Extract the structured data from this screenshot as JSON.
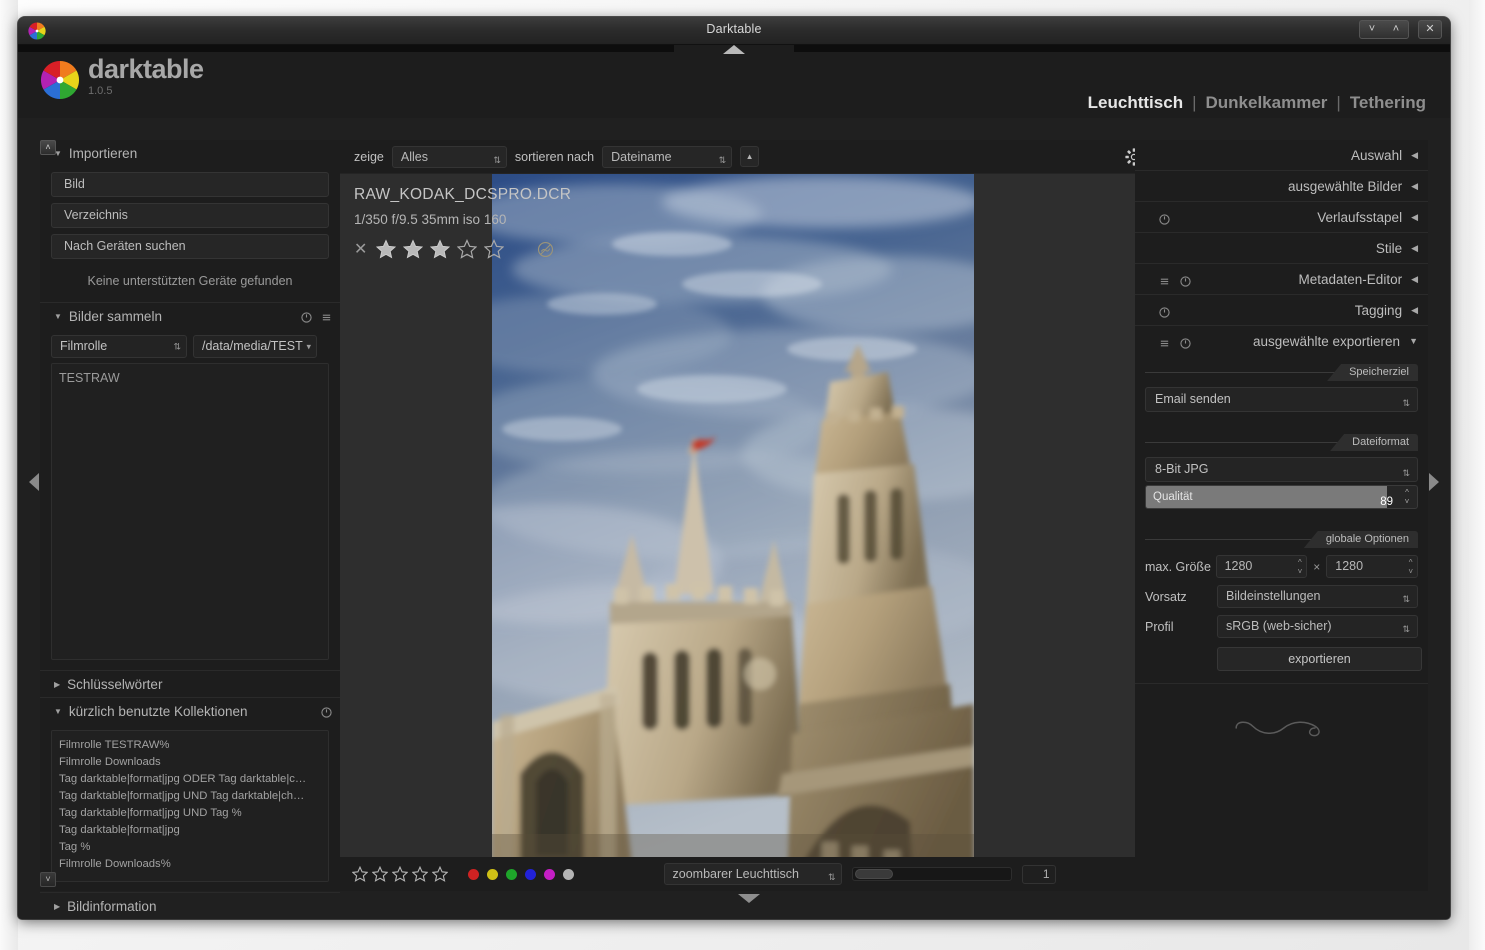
{
  "window": {
    "title": "Darktable",
    "minimize_label": "˅",
    "maximize_label": "˄",
    "close_label": "✕"
  },
  "brand": {
    "name": "darktable",
    "version": "1.0.5"
  },
  "views": {
    "items": [
      {
        "label": "Leuchttisch",
        "active": true
      },
      {
        "label": "Dunkelkammer",
        "active": false
      },
      {
        "label": "Tethering",
        "active": false
      }
    ],
    "separator": "|"
  },
  "left_panel": {
    "import": {
      "title": "Importieren",
      "collapsed_marker": "▼",
      "buttons": [
        {
          "label": "Bild"
        },
        {
          "label": "Verzeichnis"
        },
        {
          "label": "Nach Geräten suchen"
        }
      ],
      "hint": "Keine unterstützten Geräte gefunden"
    },
    "collect": {
      "title": "Bilder sammeln",
      "collapsed_marker": "▼",
      "criteria_value": "Filmrolle",
      "path_value": "/data/media/TEST",
      "results": [
        "TESTRAW"
      ]
    },
    "keywords": {
      "title": "Schlüsselwörter",
      "collapsed_marker": "▶"
    },
    "recent": {
      "title": "kürzlich benutzte Kollektionen",
      "collapsed_marker": "▼",
      "items": [
        "Filmrolle TESTRAW%",
        "Filmrolle Downloads",
        "Tag darktable|format|jpg ODER Tag darktable|c…",
        "Tag darktable|format|jpg UND Tag darktable|ch…",
        "Tag darktable|format|jpg UND Tag %",
        "Tag darktable|format|jpg",
        "Tag %",
        "Filmrolle Downloads%"
      ]
    },
    "imageinfo": {
      "title": "Bildinformation",
      "collapsed_marker": "▶"
    },
    "toggle_up": "˄",
    "toggle_down": "˅"
  },
  "toolbar_top": {
    "show_label": "zeige",
    "show_value": "Alles",
    "sort_label": "sortieren nach",
    "sort_value": "Dateiname",
    "sort_direction": "▲",
    "preferences_icon": "gear-icon"
  },
  "image": {
    "filename": "RAW_KODAK_DCSPRO.DCR",
    "exif": "1/350 f/9.5 35mm iso 160",
    "rating": 3,
    "max_rating": 5,
    "reject_label": "✕",
    "altered_icon": "altered-icon"
  },
  "toolbar_bottom": {
    "filter_stars": 0,
    "filter_star_count": 5,
    "color_labels": [
      {
        "name": "red",
        "hex": "#cf2222"
      },
      {
        "name": "yellow",
        "hex": "#cfc016"
      },
      {
        "name": "green",
        "hex": "#1ea52a"
      },
      {
        "name": "blue",
        "hex": "#2222d8"
      },
      {
        "name": "purple",
        "hex": "#c41ec4"
      },
      {
        "name": "grey",
        "hex": "#b4b4b4"
      }
    ],
    "layout_value": "zoombarer Leuchttisch",
    "zoom_value": "1"
  },
  "right_panel": {
    "modules": [
      {
        "title": "Auswahl",
        "marker": "◀",
        "icons": []
      },
      {
        "title": "ausgewählte Bilder",
        "marker": "◀",
        "icons": []
      },
      {
        "title": "Verlaufsstapel",
        "marker": "◀",
        "icons": [
          "reset-icon"
        ]
      },
      {
        "title": "Stile",
        "marker": "◀",
        "icons": []
      },
      {
        "title": "Metadaten-Editor",
        "marker": "◀",
        "icons": [
          "presets-icon",
          "reset-icon"
        ]
      },
      {
        "title": "Tagging",
        "marker": "◀",
        "icons": [
          "reset-icon"
        ]
      },
      {
        "title": "ausgewählte exportieren",
        "marker": "▼",
        "icons": [
          "presets-icon",
          "reset-icon"
        ]
      }
    ],
    "export": {
      "target_section": "Speicherziel",
      "target_value": "Email senden",
      "format_section": "Dateiformat",
      "format_value": "8-Bit JPG",
      "quality_label": "Qualität",
      "quality_value": "89",
      "global_section": "globale Optionen",
      "maxsize_label": "max. Größe",
      "maxsize_w": "1280",
      "maxsize_h": "1280",
      "dim_sep": "×",
      "prefix_label": "Vorsatz",
      "prefix_value": "Bildeinstellungen",
      "profile_label": "Profil",
      "profile_value": "sRGB (web-sicher)",
      "export_button": "exportieren"
    }
  },
  "colors": {
    "panel_bg": "#1d1d1d",
    "app_bg": "#202020",
    "text": "#bdbdbd",
    "slider_fill": "#7a7a7a"
  }
}
